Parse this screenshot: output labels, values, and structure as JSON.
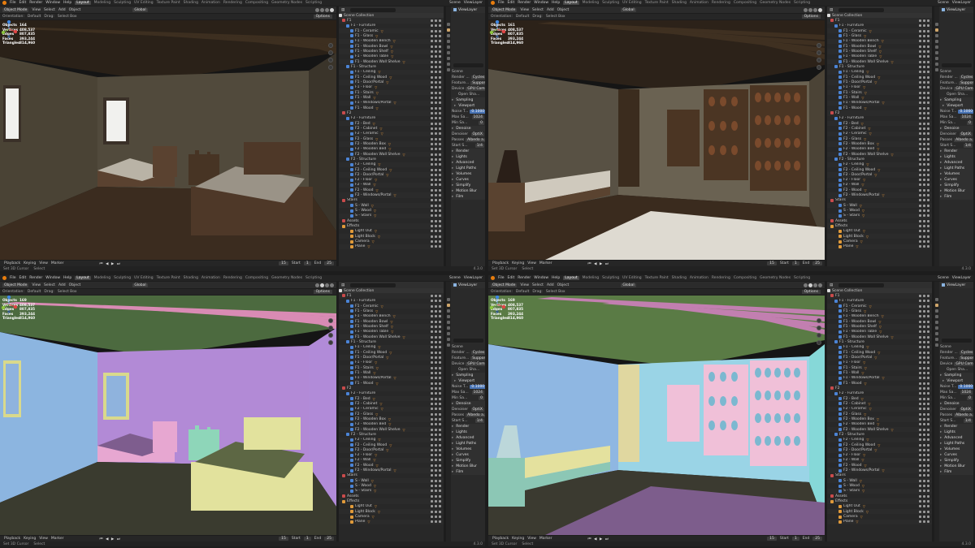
{
  "menu": {
    "items": [
      "File",
      "Edit",
      "Render",
      "Window",
      "Help"
    ],
    "workspaces": [
      "Layout",
      "Modeling",
      "Sculpting",
      "UV Editing",
      "Texture Paint",
      "Shading",
      "Animation",
      "Rendering",
      "Compositing",
      "Geometry Nodes",
      "Scripting"
    ],
    "scene": "Scene",
    "view_layer": "ViewLayer"
  },
  "header": {
    "mode": "Object Mode",
    "view": "View",
    "select": "Select",
    "add": "Add",
    "object": "Object",
    "shading": "Global",
    "orientation": "Orientation:",
    "orientation_value": "Default",
    "drag": "Drag:",
    "drag_value": "Select Box",
    "options": "Options"
  },
  "stats": [
    {
      "objects": "164",
      "vertices": "408,537",
      "edges": "807,835",
      "faces": "393,244",
      "triangles": "814,960"
    },
    {
      "objects": "161",
      "vertices": "408,537",
      "edges": "807,835",
      "faces": "393,244",
      "triangles": "814,960"
    },
    {
      "objects": "169",
      "vertices": "408,537",
      "edges": "807,835",
      "faces": "393,244",
      "triangles": "814,960"
    },
    {
      "objects": "169",
      "vertices": "408,537",
      "edges": "807,835",
      "faces": "393,244",
      "triangles": "814,960"
    }
  ],
  "stat_labels": {
    "objects": "Objects",
    "vertices": "Vertices",
    "edges": "Edges",
    "faces": "Faces",
    "triangles": "Triangles"
  },
  "outliner": {
    "title": "Scene Collection",
    "rows": [
      {
        "label": "F1",
        "c": "#c94b4b",
        "tri": false
      },
      {
        "label": "F1 - Furniture",
        "c": "#4b84d6",
        "tri": false
      },
      {
        "label": "F1 - Ceramic",
        "c": "#4b84d6",
        "tri": true
      },
      {
        "label": "F1 - Glass",
        "c": "#4b84d6",
        "tri": true
      },
      {
        "label": "F1 - Wooden Bench",
        "c": "#4b84d6",
        "tri": true
      },
      {
        "label": "F1 - Wooden Bowl",
        "c": "#4b84d6",
        "tri": true
      },
      {
        "label": "F1 - Wooden Shelf",
        "c": "#4b84d6",
        "tri": true
      },
      {
        "label": "F1 - Wooden Table",
        "c": "#4b84d6",
        "tri": true
      },
      {
        "label": "F1 - Wooden Wall Shelve",
        "c": "#4b84d6",
        "tri": true
      },
      {
        "label": "F1 - Structure",
        "c": "#4b84d6",
        "tri": false
      },
      {
        "label": "F1 - Ceiling",
        "c": "#4b84d6",
        "tri": true
      },
      {
        "label": "F1 - Ceiling Wood",
        "c": "#4b84d6",
        "tri": true
      },
      {
        "label": "F1 - Door/Portal",
        "c": "#4b84d6",
        "tri": true
      },
      {
        "label": "F1 - Floor",
        "c": "#4b84d6",
        "tri": true
      },
      {
        "label": "F1 - Stairs",
        "c": "#4b84d6",
        "tri": true
      },
      {
        "label": "F1 - Wall",
        "c": "#4b84d6",
        "tri": true
      },
      {
        "label": "F1 - Windows/Portal",
        "c": "#4b84d6",
        "tri": true
      },
      {
        "label": "F1 - Wood",
        "c": "#4b84d6",
        "tri": true
      },
      {
        "label": "F2",
        "c": "#c94b4b",
        "tri": false
      },
      {
        "label": "F2 - Furniture",
        "c": "#4b84d6",
        "tri": false
      },
      {
        "label": "F2 - Bed",
        "c": "#4b84d6",
        "tri": true
      },
      {
        "label": "F2 - Cabinet",
        "c": "#4b84d6",
        "tri": true
      },
      {
        "label": "F2 - Ceramic",
        "c": "#4b84d6",
        "tri": true
      },
      {
        "label": "F2 - Glass",
        "c": "#4b84d6",
        "tri": true
      },
      {
        "label": "F2 - Wooden Box",
        "c": "#4b84d6",
        "tri": true
      },
      {
        "label": "F2 - Wooden Bed",
        "c": "#4b84d6",
        "tri": true
      },
      {
        "label": "F2 - Wooden Wall Shelve",
        "c": "#4b84d6",
        "tri": true
      },
      {
        "label": "F2 - Structure",
        "c": "#4b84d6",
        "tri": false
      },
      {
        "label": "F2 - Ceiling",
        "c": "#4b84d6",
        "tri": true
      },
      {
        "label": "F2 - Ceiling Wood",
        "c": "#4b84d6",
        "tri": true
      },
      {
        "label": "F2 - Door/Portal",
        "c": "#4b84d6",
        "tri": true
      },
      {
        "label": "F2 - Floor",
        "c": "#4b84d6",
        "tri": true
      },
      {
        "label": "F2 - Wall",
        "c": "#4b84d6",
        "tri": true
      },
      {
        "label": "F2 - Wood",
        "c": "#4b84d6",
        "tri": true
      },
      {
        "label": "F2 - Windows/Portal",
        "c": "#4b84d6",
        "tri": true
      },
      {
        "label": "Stairs",
        "c": "#c94b4b",
        "tri": false
      },
      {
        "label": "S - Wall",
        "c": "#4b84d6",
        "tri": true
      },
      {
        "label": "S - Wood",
        "c": "#4b84d6",
        "tri": true
      },
      {
        "label": "S - Stairs",
        "c": "#4b84d6",
        "tri": true
      },
      {
        "label": "Assets",
        "c": "#c94b4b",
        "tri": false
      },
      {
        "label": "Effects",
        "c": "#e09a3a",
        "tri": false
      },
      {
        "label": "Light Out",
        "c": "#e09a3a",
        "tri": true
      },
      {
        "label": "Light Block",
        "c": "#e09a3a",
        "tri": true
      },
      {
        "label": "Camera",
        "c": "#e09a3a",
        "tri": true
      },
      {
        "label": "Plane",
        "c": "#e09a3a",
        "tri": true
      }
    ]
  },
  "props": {
    "view_layer": "ViewLayer",
    "scene": "Scene",
    "render_engine_label": "Render ...",
    "render_engine": "Cycles",
    "feature_label": "Feature...",
    "feature": "Supported",
    "device_label": "Device",
    "device": "GPU Com...",
    "open_shading": "Open Sha...",
    "sampling": "Sampling",
    "viewport": "Viewport",
    "noise_label": "Noise T...",
    "noise": "0.1000",
    "max_label": "Max Sa...",
    "max": "1024",
    "min_label": "Min Sa...",
    "min": "0",
    "denoise": "Denoise",
    "denoiser_label": "Denoiser",
    "denoiser": "OptiX",
    "passes_label": "Passes",
    "passes": "Albedo a...",
    "start_label": "Start S...",
    "start": "1/4",
    "sections": [
      "Render",
      "Lights",
      "Advanced",
      "Light Paths",
      "Volumes",
      "Curves",
      "Simplify",
      "Motion Blur",
      "Film"
    ]
  },
  "timeline": {
    "playback": "Playback",
    "keying": "Keying",
    "view": "View",
    "marker": "Marker",
    "frame": "15",
    "start_label": "Start",
    "start": "1",
    "end_label": "End",
    "end": "25"
  },
  "status": {
    "cursor": "Set 3D Cursor",
    "select": "Select",
    "version": "4.3.0"
  }
}
